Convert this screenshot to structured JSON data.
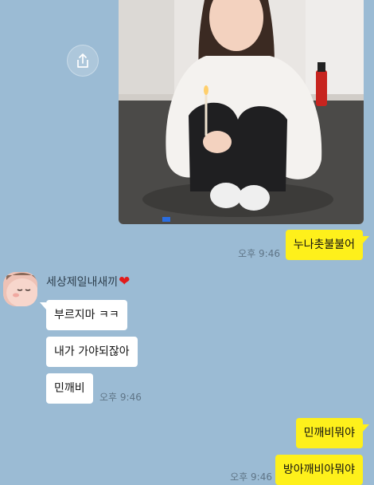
{
  "colors": {
    "background": "#9bbbd4",
    "my_bubble": "#fef01b",
    "their_bubble": "#ffffff"
  },
  "photo": {
    "icon": "photo-image",
    "share_icon": "share-icon"
  },
  "messages": {
    "m1": {
      "text": "누나촛불불어",
      "time": "오후 9:46"
    },
    "sender_name": "세상제일내새끼",
    "sender_heart": "❤",
    "m2": {
      "text": "부르지마 ㅋㅋ"
    },
    "m3": {
      "text": "내가 가야되잖아"
    },
    "m4": {
      "text": "민깨비",
      "time": "오후 9:46"
    },
    "m5": {
      "text": "민깨비뭐야"
    },
    "m6": {
      "text": "방아깨비아뭐야",
      "time": "오후 9:46"
    }
  }
}
